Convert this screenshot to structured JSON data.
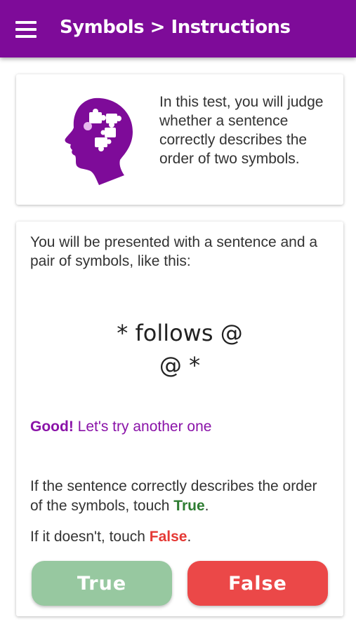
{
  "appbar": {
    "title": "Symbols > Instructions",
    "menu_icon": "hamburger-menu-icon",
    "color": "#7e0b99"
  },
  "intro": {
    "icon": "brain-puzzle-icon",
    "text": "In this test, you will judge whether a sentence correctly describes the order of two symbols."
  },
  "main": {
    "text": "You will be presented with a sentence and a pair of symbols, like this:",
    "sentence": "* follows @",
    "symbols": "@ *",
    "feedback_strong": "Good!",
    "feedback_rest": " Let's try another one",
    "instruction1_pre": "If the sentence correctly describes the order of the symbols, touch ",
    "instruction1_highlight": "True",
    "instruction1_post": ".",
    "instruction2_pre": "If it doesn't, touch ",
    "instruction2_highlight": "False",
    "instruction2_post": "."
  },
  "buttons": {
    "true_label": "True",
    "false_label": "False",
    "true_color": "#97c8a0",
    "false_color": "#eb4848"
  }
}
